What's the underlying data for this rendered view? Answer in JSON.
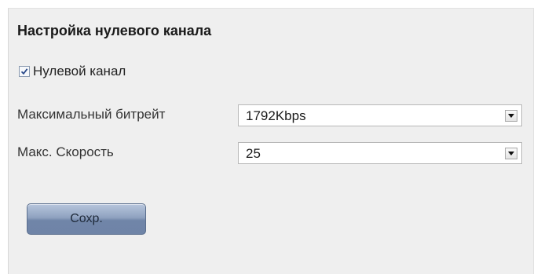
{
  "section": {
    "title": "Настройка нулевого канала"
  },
  "zero_channel": {
    "label": "Нулевой канал",
    "checked": true
  },
  "fields": {
    "max_bitrate": {
      "label": "Максимальный битрейт",
      "value": "1792Kbps"
    },
    "max_framerate": {
      "label": "Макс. Скорость",
      "value": "25"
    }
  },
  "actions": {
    "save_label": "Сохр."
  },
  "icons": {
    "checkbox": "checkmark-icon",
    "dropdown": "chevron-down-icon"
  },
  "colors": {
    "panel_bg": "#efefef",
    "button": "#7f94b5"
  }
}
